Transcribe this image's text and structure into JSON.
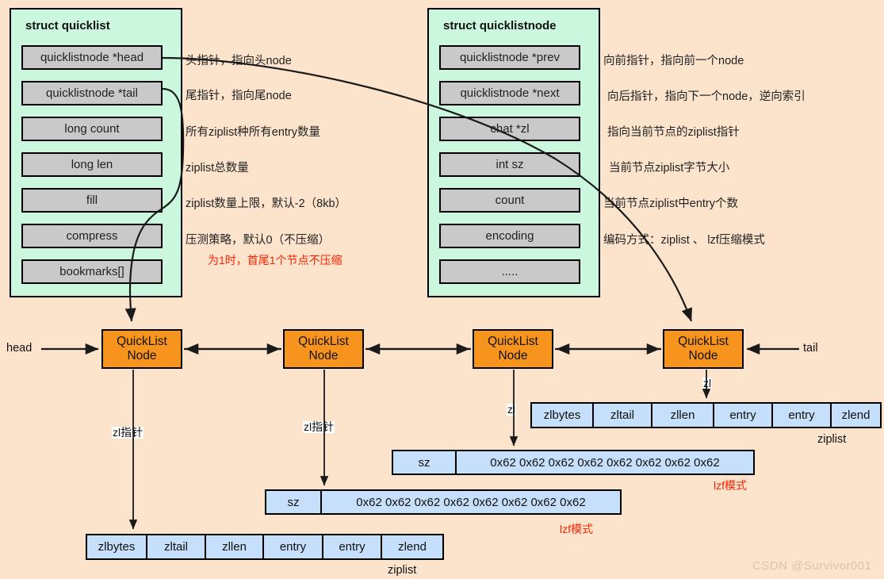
{
  "background_color": "#FBE3CC",
  "colors": {
    "panel_green": "#CCF7DF",
    "field_gray": "#C9C9C9",
    "node_orange": "#F7941E",
    "ziplist_blue": "#C6DFFA",
    "red_note": "#FF2200",
    "stroke": "#000000"
  },
  "quicklist_struct": {
    "title": "struct quicklist",
    "fields": [
      {
        "label": "quicklistnode *head",
        "note": "头指针，指向头node"
      },
      {
        "label": "quicklistnode *tail",
        "note": "尾指针，指向尾node"
      },
      {
        "label": "long count",
        "note": "所有ziplist种所有entry数量"
      },
      {
        "label": "long len",
        "note": "ziplist总数量"
      },
      {
        "label": "fill",
        "note": "ziplist数量上限，默认-2（8kb）"
      },
      {
        "label": "compress",
        "note": "压测策略，默认0（不压缩）"
      },
      {
        "label": "bookmarks[]",
        "note": ""
      }
    ],
    "red_note": "为1时，首尾1个节点不压缩"
  },
  "quicklistnode_struct": {
    "title": "struct quicklistnode",
    "fields": [
      {
        "label": "quicklistnode *prev",
        "note": "向前指针，指向前一个node"
      },
      {
        "label": "quicklistnode *next",
        "note": "向后指针，指向下一个node，逆向索引"
      },
      {
        "label": "chat *zl",
        "note": "指向当前节点的ziplist指针"
      },
      {
        "label": "int sz",
        "note": "当前节点ziplist字节大小"
      },
      {
        "label": "count",
        "note": "当前节点ziplist中entry个数"
      },
      {
        "label": "encoding",
        "note": "编码方式：ziplist 、 lzf压缩模式"
      },
      {
        "label": ".....",
        "note": ""
      }
    ]
  },
  "list": {
    "head_label": "head",
    "tail_label": "tail",
    "node_line1": "QuickList",
    "node_line2": "Node",
    "nodes": [
      {
        "pointer_label": "zl指针"
      },
      {
        "pointer_label": "zl指针"
      },
      {
        "pointer_label": "zl"
      },
      {
        "pointer_label": "zl"
      }
    ]
  },
  "ziplists": [
    {
      "id": "ziplist-bottom-left",
      "caption": "ziplist",
      "cells": [
        "zlbytes",
        "zltail",
        "zllen",
        "entry",
        "entry",
        "zlend"
      ]
    },
    {
      "id": "ziplist-right",
      "caption": "ziplist",
      "cells": [
        "zlbytes",
        "zltail",
        "zllen",
        "entry",
        "entry",
        "zlend"
      ]
    }
  ],
  "lzf_blocks": [
    {
      "id": "lzf-upper",
      "sz_label": "sz",
      "data": "0x62 0x62 0x62 0x62 0x62 0x62 0x62 0x62",
      "caption": "lzf模式"
    },
    {
      "id": "lzf-lower",
      "sz_label": "sz",
      "data": "0x62 0x62 0x62 0x62 0x62 0x62 0x62 0x62",
      "caption": "lzf模式"
    }
  ],
  "watermark": "CSDN @Survivor001"
}
